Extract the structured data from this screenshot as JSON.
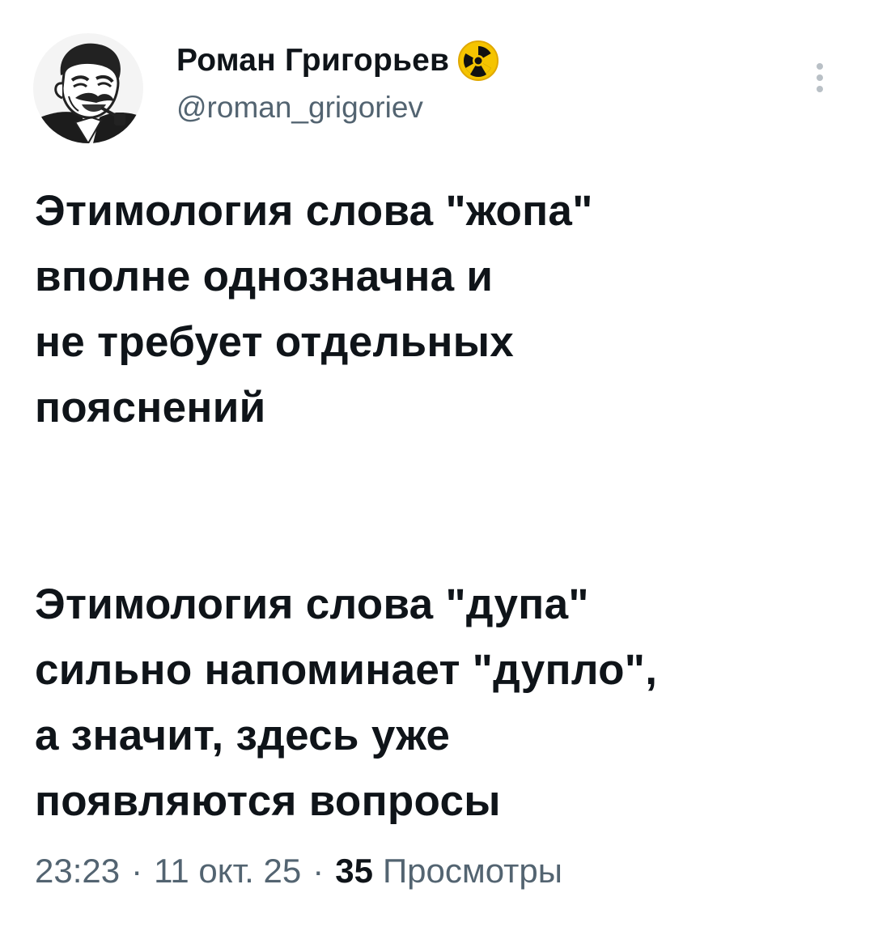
{
  "author": {
    "name": "Роман Григорьев",
    "handle": "@roman_grigoriev",
    "avatar_icon": "caricature-avatar",
    "badge_icon": "radioactive-icon",
    "badge_color": "#f5c400"
  },
  "tweet": {
    "paragraphs": [
      [
        "Этимология слова \"жопа\"",
        "вполне однозначна и",
        "не требует отдельных",
        "пояснений"
      ],
      [
        "Этимология слова \"дупа\"",
        "сильно напоминает \"дупло\",",
        "а значит, здесь уже",
        "появляются вопросы"
      ]
    ]
  },
  "meta": {
    "time": "23:23",
    "separator": "·",
    "date": "11 окт. 25",
    "views_count": "35",
    "views_label": "Просмотры"
  },
  "colors": {
    "text_primary": "#0f1419",
    "text_secondary": "#536471",
    "more_dots": "#b9c0c6"
  },
  "more_icon": "more-vertical-icon"
}
